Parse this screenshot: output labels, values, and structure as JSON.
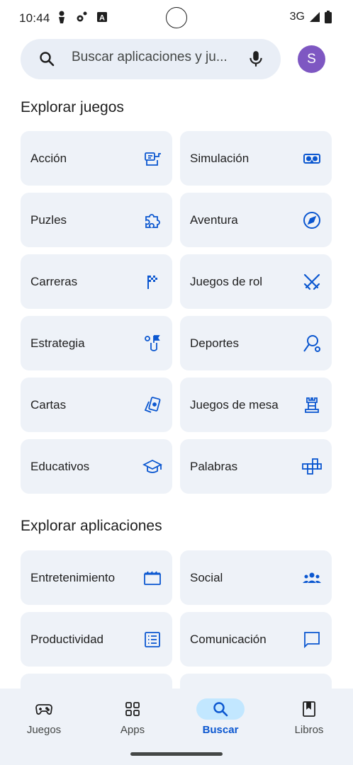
{
  "status_bar": {
    "time": "10:44",
    "network": "3G",
    "left_icons": [
      "person-icon",
      "settings-icon",
      "translate-icon"
    ],
    "right_icons": [
      "signal-icon",
      "battery-icon"
    ]
  },
  "search": {
    "placeholder": "Buscar aplicaciones y ju...",
    "avatar_letter": "S",
    "avatar_color": "#7e57c2"
  },
  "games_section": {
    "title": "Explorar juegos",
    "categories": [
      {
        "label": "Acción",
        "icon": "arcade-icon"
      },
      {
        "label": "Simulación",
        "icon": "vr-headset-icon"
      },
      {
        "label": "Puzles",
        "icon": "puzzle-icon"
      },
      {
        "label": "Aventura",
        "icon": "compass-icon"
      },
      {
        "label": "Carreras",
        "icon": "checkered-flag-icon"
      },
      {
        "label": "Juegos de rol",
        "icon": "crossed-swords-icon"
      },
      {
        "label": "Estrategia",
        "icon": "strategy-flag-icon"
      },
      {
        "label": "Deportes",
        "icon": "racket-icon"
      },
      {
        "label": "Cartas",
        "icon": "cards-icon"
      },
      {
        "label": "Juegos de mesa",
        "icon": "chess-rook-icon"
      },
      {
        "label": "Educativos",
        "icon": "graduation-cap-icon"
      },
      {
        "label": "Palabras",
        "icon": "word-blocks-icon"
      }
    ]
  },
  "apps_section": {
    "title": "Explorar aplicaciones",
    "categories": [
      {
        "label": "Entretenimiento",
        "icon": "clapperboard-icon"
      },
      {
        "label": "Social",
        "icon": "group-icon"
      },
      {
        "label": "Productividad",
        "icon": "checklist-icon"
      },
      {
        "label": "Comunicación",
        "icon": "chat-bubble-icon"
      }
    ]
  },
  "bottom_nav": {
    "items": [
      {
        "label": "Juegos",
        "icon": "gamepad-icon",
        "active": false
      },
      {
        "label": "Apps",
        "icon": "apps-grid-icon",
        "active": false
      },
      {
        "label": "Buscar",
        "icon": "search-icon",
        "active": true
      },
      {
        "label": "Libros",
        "icon": "book-icon",
        "active": false
      }
    ]
  },
  "colors": {
    "accent": "#0b57d0",
    "tile_background": "#eef2f8",
    "search_background": "#e9eef6",
    "active_pill": "#c2e7ff"
  }
}
